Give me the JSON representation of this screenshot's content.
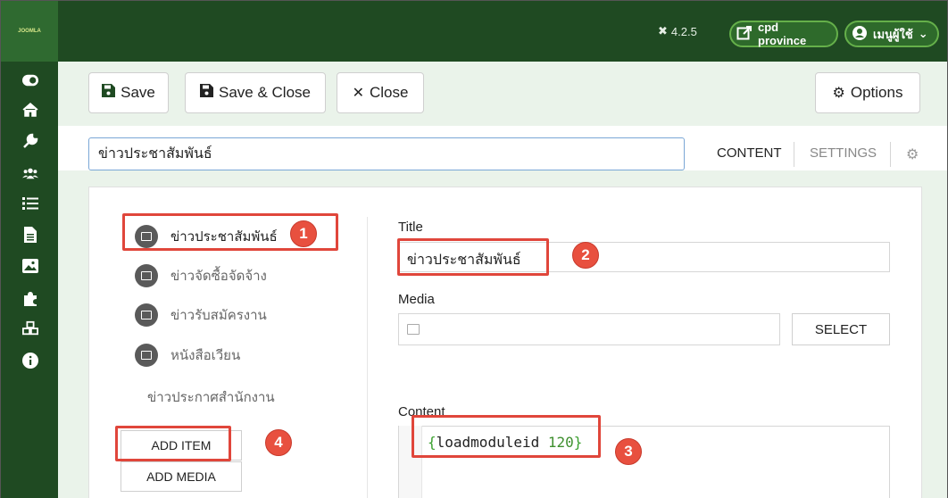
{
  "topbar": {
    "logo_text": "JOOMLA",
    "version": "4.2.5",
    "site_label": "cpd province",
    "user_label": "เมนูผู้ใช้"
  },
  "toolbar": {
    "save_label": "Save",
    "save_close_label": "Save & Close",
    "close_label": "Close",
    "options_label": "Options"
  },
  "title_field": {
    "value": "ข่าวประชาสัมพันธ์"
  },
  "tabs": {
    "content": "CONTENT",
    "settings": "SETTINGS"
  },
  "items": [
    {
      "label": "ข่าวประชาสัมพันธ์"
    },
    {
      "label": "ข่าวจัดซื้อจัดจ้าง"
    },
    {
      "label": "ข่าวรับสมัครงาน"
    },
    {
      "label": "หนังสือเวียน"
    },
    {
      "label": "ข่าวประกาศสำนักงาน"
    }
  ],
  "buttons": {
    "add_item": "ADD ITEM",
    "add_media": "ADD MEDIA",
    "select": "SELECT"
  },
  "form": {
    "title_label": "Title",
    "title_value": "ข่าวประชาสัมพันธ์",
    "media_label": "Media",
    "content_label": "Content",
    "content_open": "{",
    "content_keyword": "loadmoduleid",
    "content_number": "120",
    "content_close": "}"
  },
  "annotations": [
    "1",
    "2",
    "3",
    "4"
  ],
  "colors": {
    "sidebar": "#1f4a22",
    "accent": "#65b04a",
    "highlight": "#e0463b"
  }
}
